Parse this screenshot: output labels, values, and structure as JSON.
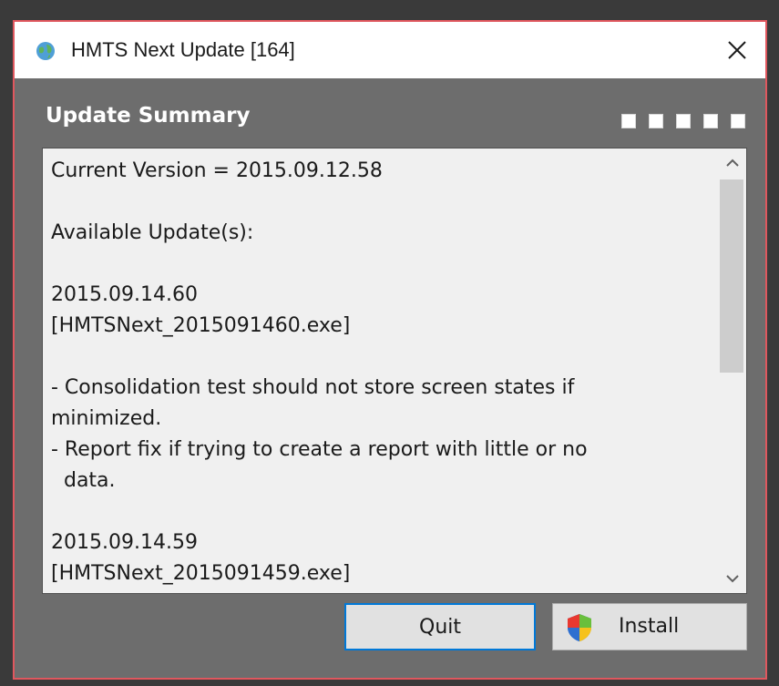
{
  "window": {
    "title": "HMTS Next Update [164]"
  },
  "summary": {
    "heading": "Update Summary",
    "steps": 5,
    "lines": [
      "Current Version = 2015.09.12.58",
      "",
      "Available Update(s):",
      "",
      "2015.09.14.60",
      "[HMTSNext_2015091460.exe]",
      "",
      "- Consolidation test should not store screen states if",
      "minimized.",
      "- Report fix if trying to create a report with little or no",
      "  data.",
      "",
      "2015.09.14.59",
      "[HMTSNext_2015091459.exe]"
    ]
  },
  "buttons": {
    "quit_label": "Quit",
    "install_label": "Install"
  },
  "colors": {
    "window_border": "#e0575e",
    "body_bg": "#6d6d6d",
    "focus_border": "#0078d7"
  },
  "icons": {
    "app": "globe-icon",
    "close": "close-icon",
    "install": "uac-shield-icon"
  }
}
